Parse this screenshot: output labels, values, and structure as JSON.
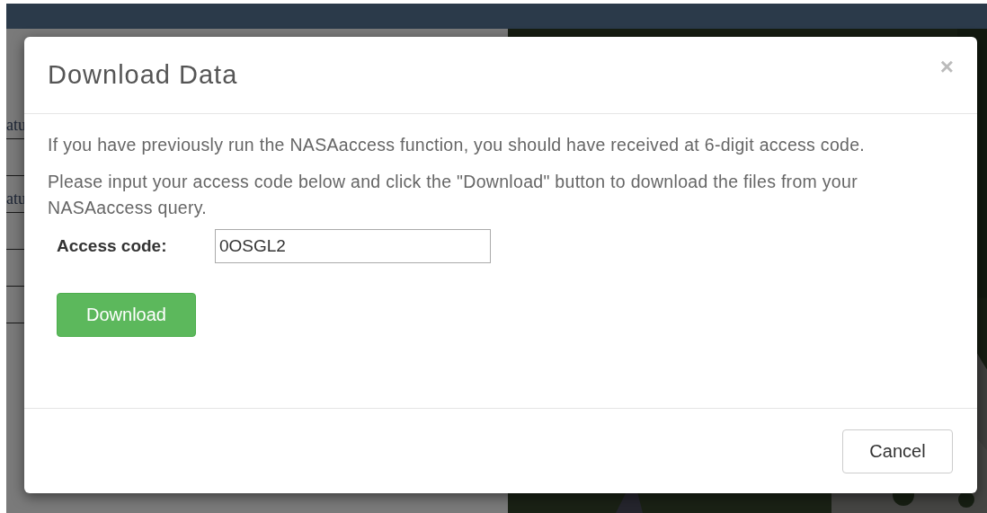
{
  "background": {
    "side_labels": [
      "atu",
      "atu"
    ]
  },
  "dialog": {
    "title": "Download Data",
    "close": "×",
    "paragraphs": [
      "If you have previously run the NASAaccess function, you should have received at 6-digit access code.",
      "Please input your access code below and click the \"Download\" button to download the files from your NASAaccess query."
    ],
    "field": {
      "label": "Access code:",
      "value": "0OSGL2"
    },
    "primary_button": "Download",
    "cancel_button": "Cancel"
  }
}
